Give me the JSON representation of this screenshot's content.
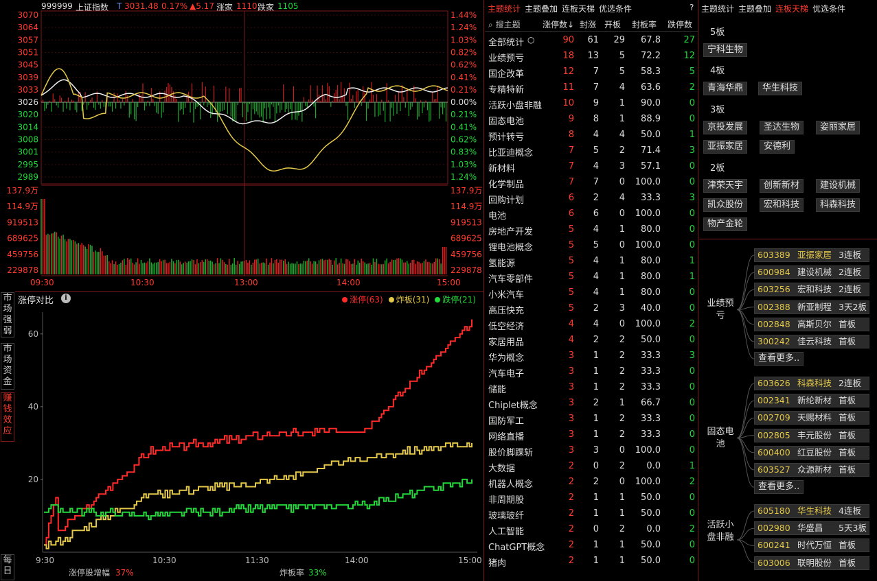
{
  "header": {
    "code": "999999",
    "name": "上证指数",
    "t": "T",
    "price": "3031.48",
    "pct": "0.17%",
    "change": "▲5.17",
    "up_label": "涨家",
    "up_count": "1110",
    "down_label": "跌家",
    "down_count": "1105"
  },
  "index_chart": {
    "left_ticks": [
      "3070",
      "3064",
      "3057",
      "3051",
      "3045",
      "3039",
      "3033",
      "3026",
      "3020",
      "3014",
      "3008",
      "3001",
      "2995",
      "2989"
    ],
    "right_ticks": [
      "1.44%",
      "1.24%",
      "1.03%",
      "0.82%",
      "0.62%",
      "0.41%",
      "0.21%",
      "0.00%",
      "0.21%",
      "0.41%",
      "0.62%",
      "0.83%",
      "1.03%",
      "1.24%"
    ],
    "vol_left_ticks": [
      "137.9万",
      "114.9万",
      "919513",
      "689625",
      "459756",
      "229878"
    ],
    "vol_right_ticks": [
      "137.9万",
      "114.9万",
      "919513",
      "689625",
      "459756",
      "229878"
    ],
    "time_ticks": [
      "09:30",
      "10:30",
      "13:00",
      "14:00",
      "15:00"
    ]
  },
  "compare_chart": {
    "title": "涨停对比",
    "info_icon": "info-icon",
    "legend": [
      {
        "label": "涨停(63)",
        "color": "#ff2a2a"
      },
      {
        "label": "炸板(31)",
        "color": "#e4c84a"
      },
      {
        "label": "跌停(21)",
        "color": "#22d83a"
      }
    ],
    "y_ticks": [
      "60",
      "40",
      "20"
    ],
    "time_ticks": [
      "9:30",
      "10:30",
      "11:30",
      "14:00",
      "15:00"
    ],
    "footer_label_1": "涨停股增幅",
    "footer_value_1": "37%",
    "footer_label_2": "炸板率",
    "footer_value_2": "33%"
  },
  "chart_data": {
    "type": "line",
    "x": [
      "9:30",
      "10:30",
      "11:30",
      "14:00",
      "15:00"
    ],
    "series": [
      {
        "name": "涨停(63)",
        "color": "#ff2a2a",
        "values": [
          2,
          28,
          32,
          34,
          63
        ]
      },
      {
        "name": "炸板(31)",
        "color": "#e4c84a",
        "values": [
          1,
          16,
          19,
          26,
          30
        ]
      },
      {
        "name": "跌停(21)",
        "color": "#22d83a",
        "values": [
          12,
          10,
          12,
          13,
          20
        ]
      }
    ],
    "ylim": [
      0,
      66
    ]
  },
  "side_tabs": [
    "市场强弱",
    "市场资金",
    "赚钱效应",
    "每日"
  ],
  "mid": {
    "tabs": [
      "主题统计",
      "主题叠加",
      "连板天梯",
      "优选条件"
    ],
    "help": "?",
    "search_label": "搜主题",
    "columns": [
      "涨停数↓",
      "封涨",
      "开板",
      "封板率",
      "跌停数"
    ],
    "rows": [
      [
        "全部统计",
        "90",
        "61",
        "29",
        "67.8",
        "27"
      ],
      [
        "业绩预亏",
        "18",
        "13",
        "5",
        "72.2",
        "12"
      ],
      [
        "国企改革",
        "12",
        "7",
        "5",
        "58.3",
        "5"
      ],
      [
        "专精特新",
        "11",
        "7",
        "4",
        "63.6",
        "2"
      ],
      [
        "活跃小盘非融",
        "10",
        "9",
        "1",
        "90.0",
        "0"
      ],
      [
        "固态电池",
        "9",
        "8",
        "1",
        "88.9",
        "0"
      ],
      [
        "预计转亏",
        "8",
        "4",
        "4",
        "50.0",
        "1"
      ],
      [
        "比亚迪概念",
        "7",
        "5",
        "2",
        "71.4",
        "3"
      ],
      [
        "新材料",
        "7",
        "4",
        "3",
        "57.1",
        "0"
      ],
      [
        "化学制品",
        "7",
        "7",
        "0",
        "100.0",
        "0"
      ],
      [
        "回购计划",
        "6",
        "2",
        "4",
        "33.3",
        "3"
      ],
      [
        "电池",
        "6",
        "6",
        "0",
        "100.0",
        "0"
      ],
      [
        "房地产开发",
        "5",
        "4",
        "1",
        "80.0",
        "0"
      ],
      [
        "锂电池概念",
        "5",
        "5",
        "0",
        "100.0",
        "0"
      ],
      [
        "氢能源",
        "5",
        "4",
        "1",
        "80.0",
        "1"
      ],
      [
        "汽车零部件",
        "5",
        "4",
        "1",
        "80.0",
        "1"
      ],
      [
        "小米汽车",
        "5",
        "4",
        "1",
        "80.0",
        "0"
      ],
      [
        "高压快充",
        "5",
        "2",
        "3",
        "40.0",
        "0"
      ],
      [
        "低空经济",
        "4",
        "4",
        "0",
        "100.0",
        "2"
      ],
      [
        "家居用品",
        "4",
        "2",
        "2",
        "50.0",
        "0"
      ],
      [
        "华为概念",
        "3",
        "1",
        "2",
        "33.3",
        "3"
      ],
      [
        "汽车电子",
        "3",
        "1",
        "2",
        "33.3",
        "0"
      ],
      [
        "储能",
        "3",
        "1",
        "2",
        "33.3",
        "0"
      ],
      [
        "Chiplet概念",
        "3",
        "2",
        "1",
        "66.7",
        "0"
      ],
      [
        "国防军工",
        "3",
        "1",
        "2",
        "33.3",
        "0"
      ],
      [
        "网络直播",
        "3",
        "1",
        "2",
        "33.3",
        "0"
      ],
      [
        "股价脚踝斩",
        "3",
        "3",
        "0",
        "100.0",
        "0"
      ],
      [
        "大数据",
        "2",
        "0",
        "2",
        "0.0",
        "1"
      ],
      [
        "机器人概念",
        "2",
        "2",
        "0",
        "100.0",
        "2"
      ],
      [
        "非周期股",
        "2",
        "1",
        "1",
        "50.0",
        "0"
      ],
      [
        "玻璃玻纤",
        "2",
        "1",
        "1",
        "50.0",
        "0"
      ],
      [
        "人工智能",
        "2",
        "0",
        "2",
        "0.0",
        "2"
      ],
      [
        "ChatGPT概念",
        "2",
        "1",
        "1",
        "50.0",
        "0"
      ],
      [
        "猪肉",
        "2",
        "1",
        "1",
        "50.0",
        "0"
      ]
    ]
  },
  "right": {
    "tabs": [
      "主题统计",
      "主题叠加",
      "连板天梯",
      "优选条件"
    ],
    "ladder": [
      {
        "level": "5板",
        "stocks": [
          "宁科生物"
        ]
      },
      {
        "level": "4板",
        "stocks": [
          "青海华鼎",
          "华生科技"
        ]
      },
      {
        "level": "3板",
        "stocks": [
          "京投发展",
          "圣达生物",
          "姿丽家居",
          "亚振家居",
          "安德利"
        ]
      },
      {
        "level": "2板",
        "stocks": [
          "津荣天宇",
          "创新新材",
          "建设机械",
          "凯众股份",
          "宏和科技",
          "科森科技",
          "物产金轮"
        ]
      }
    ],
    "groups": [
      {
        "name": "业绩预亏",
        "items": [
          [
            "603389",
            "亚振家居",
            "3连板"
          ],
          [
            "600984",
            "建设机械",
            "2连板"
          ],
          [
            "603256",
            "宏和科技",
            "2连板"
          ],
          [
            "002388",
            "新亚制程",
            "3天2板"
          ],
          [
            "002848",
            "高斯贝尔",
            "首板"
          ],
          [
            "300242",
            "佳云科技",
            "首板"
          ]
        ],
        "more": "查看更多.."
      },
      {
        "name": "固态电池",
        "items": [
          [
            "603626",
            "科森科技",
            "2连板"
          ],
          [
            "002341",
            "新纶新材",
            "首板"
          ],
          [
            "002709",
            "天赐材料",
            "首板"
          ],
          [
            "002805",
            "丰元股份",
            "首板"
          ],
          [
            "600400",
            "红豆股份",
            "首板"
          ],
          [
            "603527",
            "众源新材",
            "首板"
          ]
        ],
        "more": "查看更多.."
      },
      {
        "name": "活跃小盘非融",
        "items": [
          [
            "605180",
            "华生科技",
            "4连板"
          ],
          [
            "002980",
            "华盛昌",
            "5天3板"
          ],
          [
            "600241",
            "时代万恒",
            "首板"
          ],
          [
            "603006",
            "联明股份",
            "首板"
          ]
        ]
      }
    ]
  }
}
